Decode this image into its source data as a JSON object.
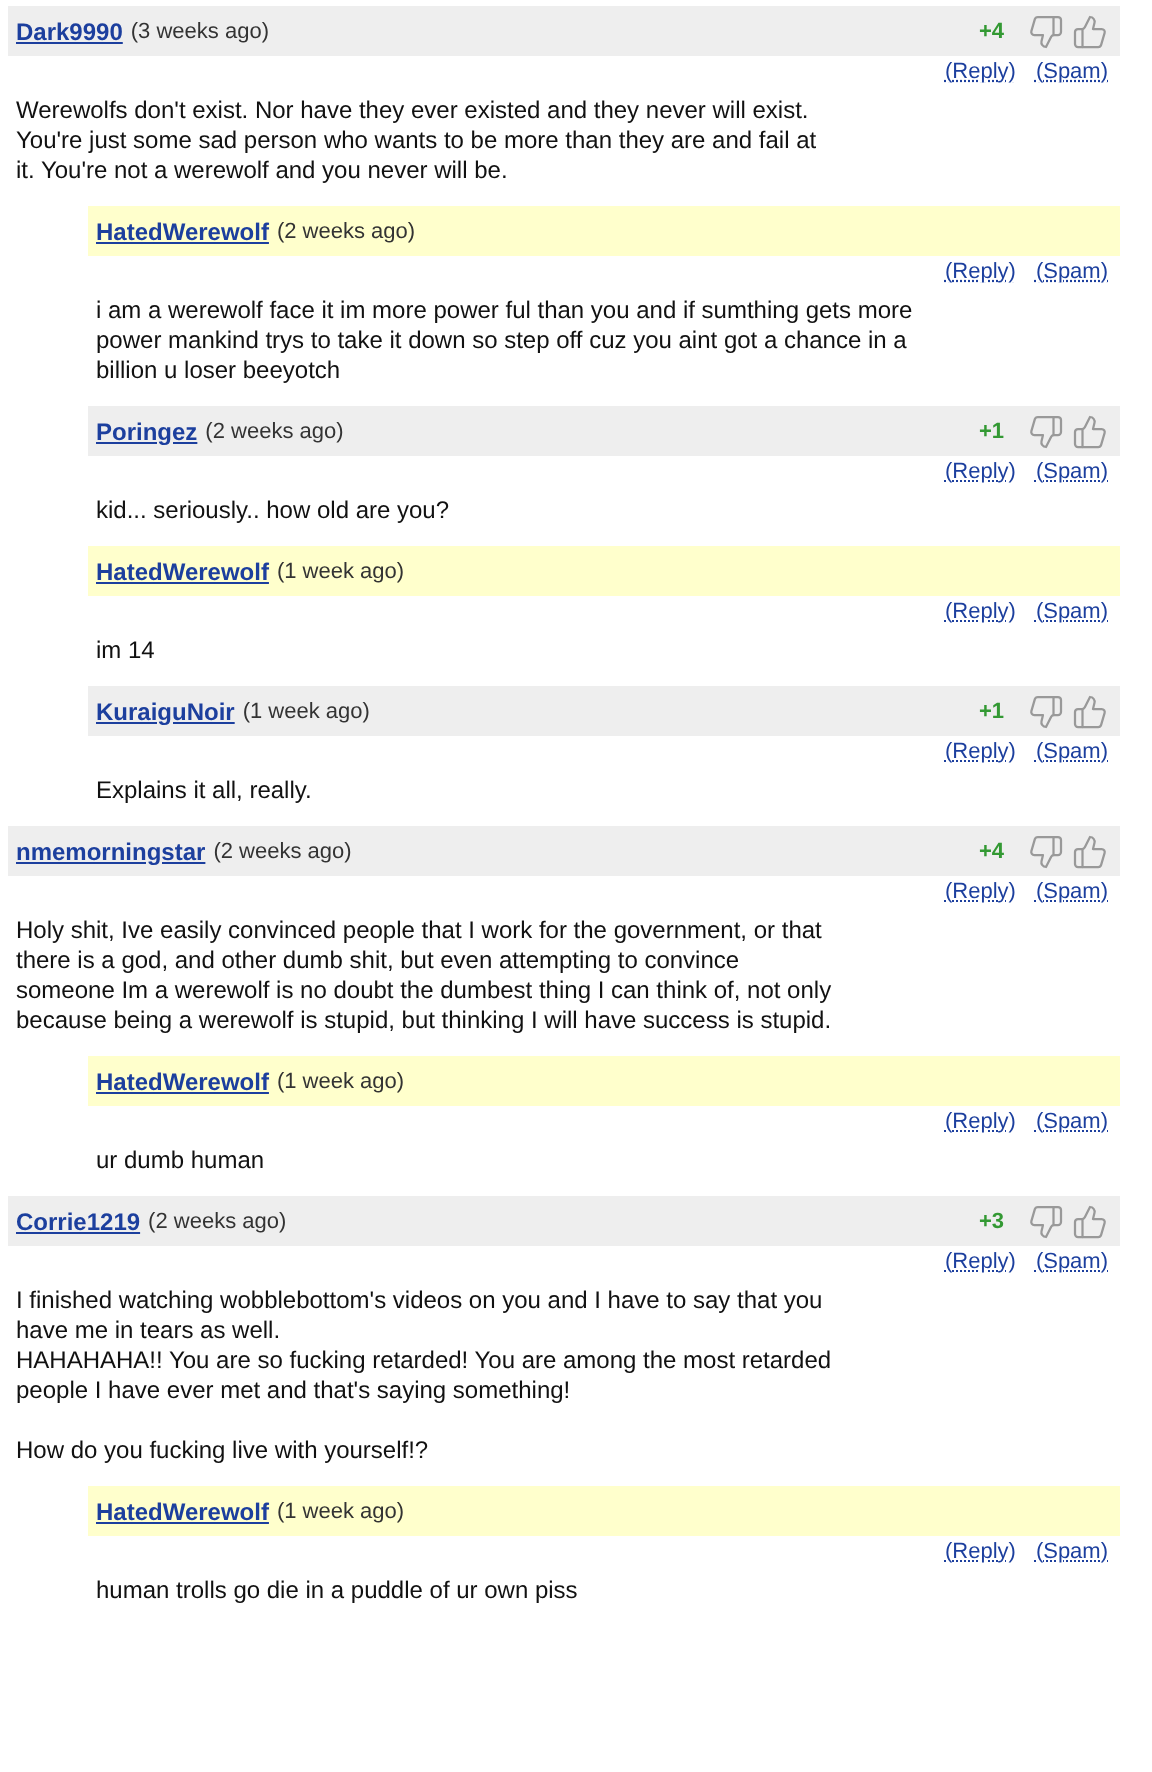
{
  "comments": [
    {
      "author": "Dark9990",
      "time": "(3 weeks ago)",
      "uploader": false,
      "score": "+4",
      "actions": [
        "(Reply)",
        "(Spam)"
      ],
      "text": "Werewolfs don't exist. Nor have they ever existed and they never will exist. You're just some sad person who wants to be more than they are and fail at it. You're not a werewolf and you never will be.",
      "children": [
        {
          "author": "HatedWerewolf",
          "time": "(2 weeks ago)",
          "uploader": true,
          "actions": [
            "(Reply)",
            "(Spam)"
          ],
          "text": "i am a werewolf face it im more power ful than you and if sumthing gets more power mankind trys to take it down so step off cuz you aint got a chance in a billion u loser beeyotch"
        },
        {
          "author": "Poringez",
          "time": "(2 weeks ago)",
          "uploader": false,
          "score": "+1",
          "actions": [
            "(Reply)",
            "(Spam)"
          ],
          "text": "kid... seriously.. how old are you?"
        },
        {
          "author": "HatedWerewolf",
          "time": "(1 week ago)",
          "uploader": true,
          "actions": [
            "(Reply)",
            "(Spam)"
          ],
          "text": "im 14"
        },
        {
          "author": "KuraiguNoir",
          "time": "(1 week ago)",
          "uploader": false,
          "score": "+1",
          "actions": [
            "(Reply)",
            "(Spam)"
          ],
          "text": "Explains it all, really."
        }
      ]
    },
    {
      "author": "nmemorningstar",
      "time": "(2 weeks ago)",
      "uploader": false,
      "score": "+4",
      "actions": [
        "(Reply)",
        "(Spam)"
      ],
      "text": "Holy shit, Ive easily convinced people that I work for the government, or that there is a god, and other dumb shit, but even attempting to convince someone Im a werewolf is no doubt the dumbest thing I can think of, not only because being a werewolf is stupid, but thinking I will have success is stupid.",
      "children": [
        {
          "author": "HatedWerewolf",
          "time": "(1 week ago)",
          "uploader": true,
          "actions": [
            "(Reply)",
            "(Spam)"
          ],
          "text": "ur dumb human"
        }
      ]
    },
    {
      "author": "Corrie1219",
      "time": "(2 weeks ago)",
      "uploader": false,
      "score": "+3",
      "actions": [
        "(Reply)",
        "(Spam)"
      ],
      "text": "I finished watching wobblebottom's videos on you and I have to say that you have me in tears as well.\nHAHAHAHA!! You are so fucking retarded! You are among the most retarded people I have ever met and that's saying something!\n\nHow do you fucking live with yourself!?",
      "children": [
        {
          "author": "HatedWerewolf",
          "time": "(1 week ago)",
          "uploader": true,
          "actions": [
            "(Reply)",
            "(Spam)"
          ],
          "text": "human trolls go die in a puddle of ur own piss"
        }
      ]
    }
  ]
}
